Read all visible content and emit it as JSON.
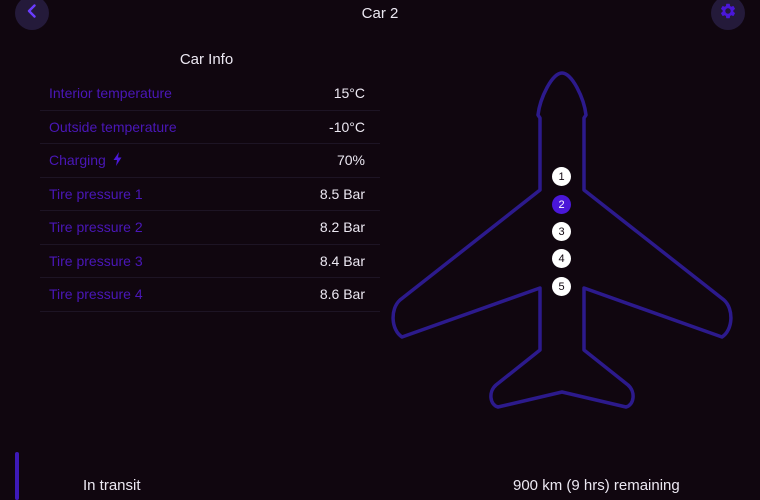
{
  "header": {
    "title": "Car 2",
    "back_icon": "chevron-left-icon",
    "settings_icon": "gear-icon"
  },
  "info": {
    "title": "Car Info",
    "rows": [
      {
        "label": "Interior temperature",
        "value": "15°C"
      },
      {
        "label": "Outside temperature",
        "value": "-10°C"
      },
      {
        "label": "Charging",
        "value": "70%",
        "icon": "lightning-bolt-icon"
      },
      {
        "label": "Tire pressure 1",
        "value": "8.5 Bar"
      },
      {
        "label": "Tire pressure 2",
        "value": "8.2 Bar"
      },
      {
        "label": "Tire pressure 3",
        "value": "8.4 Bar"
      },
      {
        "label": "Tire pressure 4",
        "value": "8.6 Bar"
      }
    ]
  },
  "diagram": {
    "markers": [
      "1",
      "2",
      "3",
      "4",
      "5"
    ],
    "selected": "2"
  },
  "status": {
    "state": "In transit",
    "remaining": "900 km (9 hrs) remaining"
  },
  "colors": {
    "background": "#10060f",
    "accent": "#4a17d8",
    "label": "#4a17b8",
    "button": "#241a3a",
    "outline": "#2c1a8c"
  }
}
